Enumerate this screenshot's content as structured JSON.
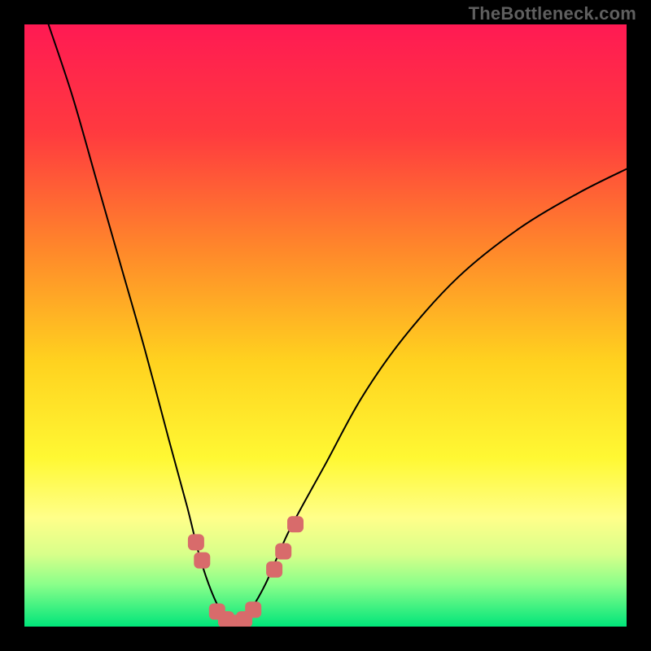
{
  "watermark": "TheBottleneck.com",
  "chart_data": {
    "type": "line",
    "title": "",
    "xlabel": "",
    "ylabel": "",
    "xlim": [
      0,
      100
    ],
    "ylim": [
      0,
      100
    ],
    "grid": false,
    "legend": false,
    "background": {
      "stops": [
        {
          "offset": 0.0,
          "color": "#ff1a53"
        },
        {
          "offset": 0.18,
          "color": "#ff3a3f"
        },
        {
          "offset": 0.38,
          "color": "#ff8a2a"
        },
        {
          "offset": 0.56,
          "color": "#ffd21f"
        },
        {
          "offset": 0.72,
          "color": "#fff833"
        },
        {
          "offset": 0.82,
          "color": "#ffff8a"
        },
        {
          "offset": 0.88,
          "color": "#d8ff8a"
        },
        {
          "offset": 0.93,
          "color": "#8aff8a"
        },
        {
          "offset": 1.0,
          "color": "#00e57a"
        }
      ]
    },
    "series": [
      {
        "name": "bottleneck-curve",
        "x": [
          4,
          8,
          12,
          16,
          20,
          24,
          27,
          29,
          31,
          33,
          35,
          37,
          40,
          44,
          50,
          56,
          63,
          72,
          82,
          92,
          100
        ],
        "y": [
          100,
          88,
          74,
          60,
          46,
          31,
          20,
          12,
          6,
          2,
          0.5,
          2,
          7,
          16,
          27,
          38,
          48,
          58,
          66,
          72,
          76
        ]
      }
    ],
    "markers": {
      "name": "sweet-spot-markers",
      "color": "#d86b6b",
      "points": [
        {
          "x": 28.5,
          "y": 14
        },
        {
          "x": 29.5,
          "y": 11
        },
        {
          "x": 32.0,
          "y": 2.5
        },
        {
          "x": 33.5,
          "y": 1.2
        },
        {
          "x": 35.0,
          "y": 0.6
        },
        {
          "x": 36.5,
          "y": 1.2
        },
        {
          "x": 38.0,
          "y": 2.8
        },
        {
          "x": 41.5,
          "y": 9.5
        },
        {
          "x": 43.0,
          "y": 12.5
        },
        {
          "x": 45.0,
          "y": 17.0
        }
      ]
    }
  }
}
